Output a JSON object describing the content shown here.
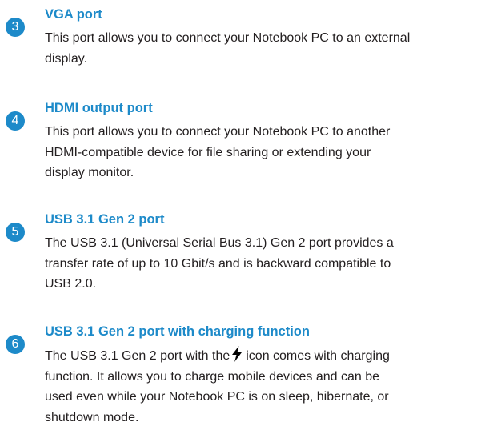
{
  "sections": [
    {
      "badge": "3",
      "title": "VGA port",
      "lines": [
        "This port allows you to connect your Notebook PC to an external",
        "display."
      ]
    },
    {
      "badge": "4",
      "title": "HDMI output port",
      "lines": [
        "This port allows you to connect your Notebook PC to another",
        "HDMI-compatible device for file sharing or extending your",
        "display monitor."
      ]
    },
    {
      "badge": "5",
      "title": "USB 3.1 Gen 2 port",
      "lines": [
        "The USB 3.1 (Universal Serial Bus 3.1) Gen 2 port provides a",
        "transfer rate of up to 10 Gbit/s and is backward compatible to",
        "USB 2.0."
      ]
    },
    {
      "badge": "6",
      "title": "USB 3.1 Gen 2 port with charging function",
      "line1_before_icon": "The USB 3.1 Gen 2 port with the",
      "icon": "lightning-bolt-icon",
      "line1_after_icon": "icon comes with charging",
      "lines": [
        "function. It allows you to charge mobile devices and can be",
        "used even while your Notebook PC is on sleep, hibernate, or",
        "shutdown mode."
      ]
    }
  ],
  "colors": {
    "accent": "#1d8ac9",
    "text": "#231f20",
    "background": "#ffffff"
  }
}
